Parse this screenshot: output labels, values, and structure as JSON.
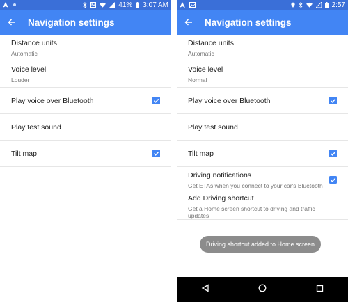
{
  "left": {
    "status": {
      "battery": "41%",
      "time": "3:07 AM"
    },
    "header": {
      "title": "Navigation settings"
    },
    "items": [
      {
        "label": "Distance units",
        "sub": "Automatic"
      },
      {
        "label": "Voice level",
        "sub": "Louder"
      },
      {
        "label": "Play voice over Bluetooth",
        "checked": true
      },
      {
        "label": "Play test sound"
      },
      {
        "label": "Tilt map",
        "checked": true
      }
    ]
  },
  "right": {
    "status": {
      "time": "2:57"
    },
    "header": {
      "title": "Navigation settings"
    },
    "items": [
      {
        "label": "Distance units",
        "sub": "Automatic"
      },
      {
        "label": "Voice level",
        "sub": "Normal"
      },
      {
        "label": "Play voice over Bluetooth",
        "checked": true
      },
      {
        "label": "Play test sound"
      },
      {
        "label": "Tilt map",
        "checked": true
      },
      {
        "label": "Driving notifications",
        "sub": "Get ETAs when you connect to your car's Bluetooth",
        "checked": true
      },
      {
        "label": "Add Driving shortcut",
        "sub": "Get a Home screen shortcut to driving and traffic updates"
      }
    ],
    "toast": "Driving shortcut added to Home screen"
  },
  "colors": {
    "status_bar": "#3a6fd8",
    "app_bar": "#4285f4",
    "checkbox": "#4285f4",
    "toast": "#8c8c8c",
    "nav_bar": "#000000"
  }
}
